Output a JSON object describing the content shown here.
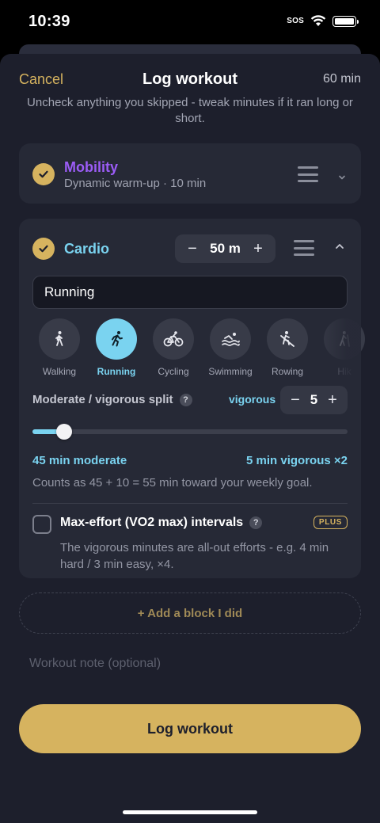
{
  "status_bar": {
    "time": "10:39",
    "sos": "SOS"
  },
  "header": {
    "cancel_label": "Cancel",
    "title": "Log workout",
    "total_minutes": "60 min",
    "subtitle": "Uncheck anything you skipped - tweak minutes if it ran long or short."
  },
  "blocks": {
    "mobility": {
      "title": "Mobility",
      "subtitle": "Dynamic warm-up · 10 min",
      "checked": true,
      "title_color": "#9b5cf6"
    },
    "cardio": {
      "title": "Cardio",
      "checked": true,
      "title_color": "#7ad3f0",
      "minutes": "50 m",
      "minus": "−",
      "plus": "+",
      "activity_value": "Running",
      "activities": [
        {
          "label": "Walking",
          "icon": "walking-icon",
          "selected": false
        },
        {
          "label": "Running",
          "icon": "running-icon",
          "selected": true
        },
        {
          "label": "Cycling",
          "icon": "cycling-icon",
          "selected": false
        },
        {
          "label": "Swimming",
          "icon": "swimming-icon",
          "selected": false
        },
        {
          "label": "Rowing",
          "icon": "rowing-icon",
          "selected": false
        },
        {
          "label": "Hik",
          "icon": "hiking-icon",
          "selected": false
        }
      ],
      "split": {
        "label": "Moderate / vigorous split",
        "help": "?",
        "vigorous_label": "vigorous",
        "vigorous_value": "5",
        "minus": "−",
        "plus": "+",
        "slider_fraction": 0.1,
        "moderate_text": "45 min moderate",
        "vigorous_text": "5 min vigorous ×2",
        "counts_text": "Counts as 45 + 10 = 55 min toward your weekly goal."
      },
      "max_effort": {
        "title": "Max-effort (VO2 max) intervals",
        "help": "?",
        "badge": "PLUS",
        "checked": false,
        "description": "The vigorous minutes are all-out efforts - e.g. 4 min hard / 3 min easy, ×4."
      }
    }
  },
  "add_block_label": "+ Add a block I did",
  "note_placeholder": "Workout note (optional)",
  "log_button_label": "Log workout",
  "colors": {
    "accent_gold": "#d6b35f",
    "accent_cyan": "#7ad3f0",
    "mobility_purple": "#9b5cf6"
  }
}
